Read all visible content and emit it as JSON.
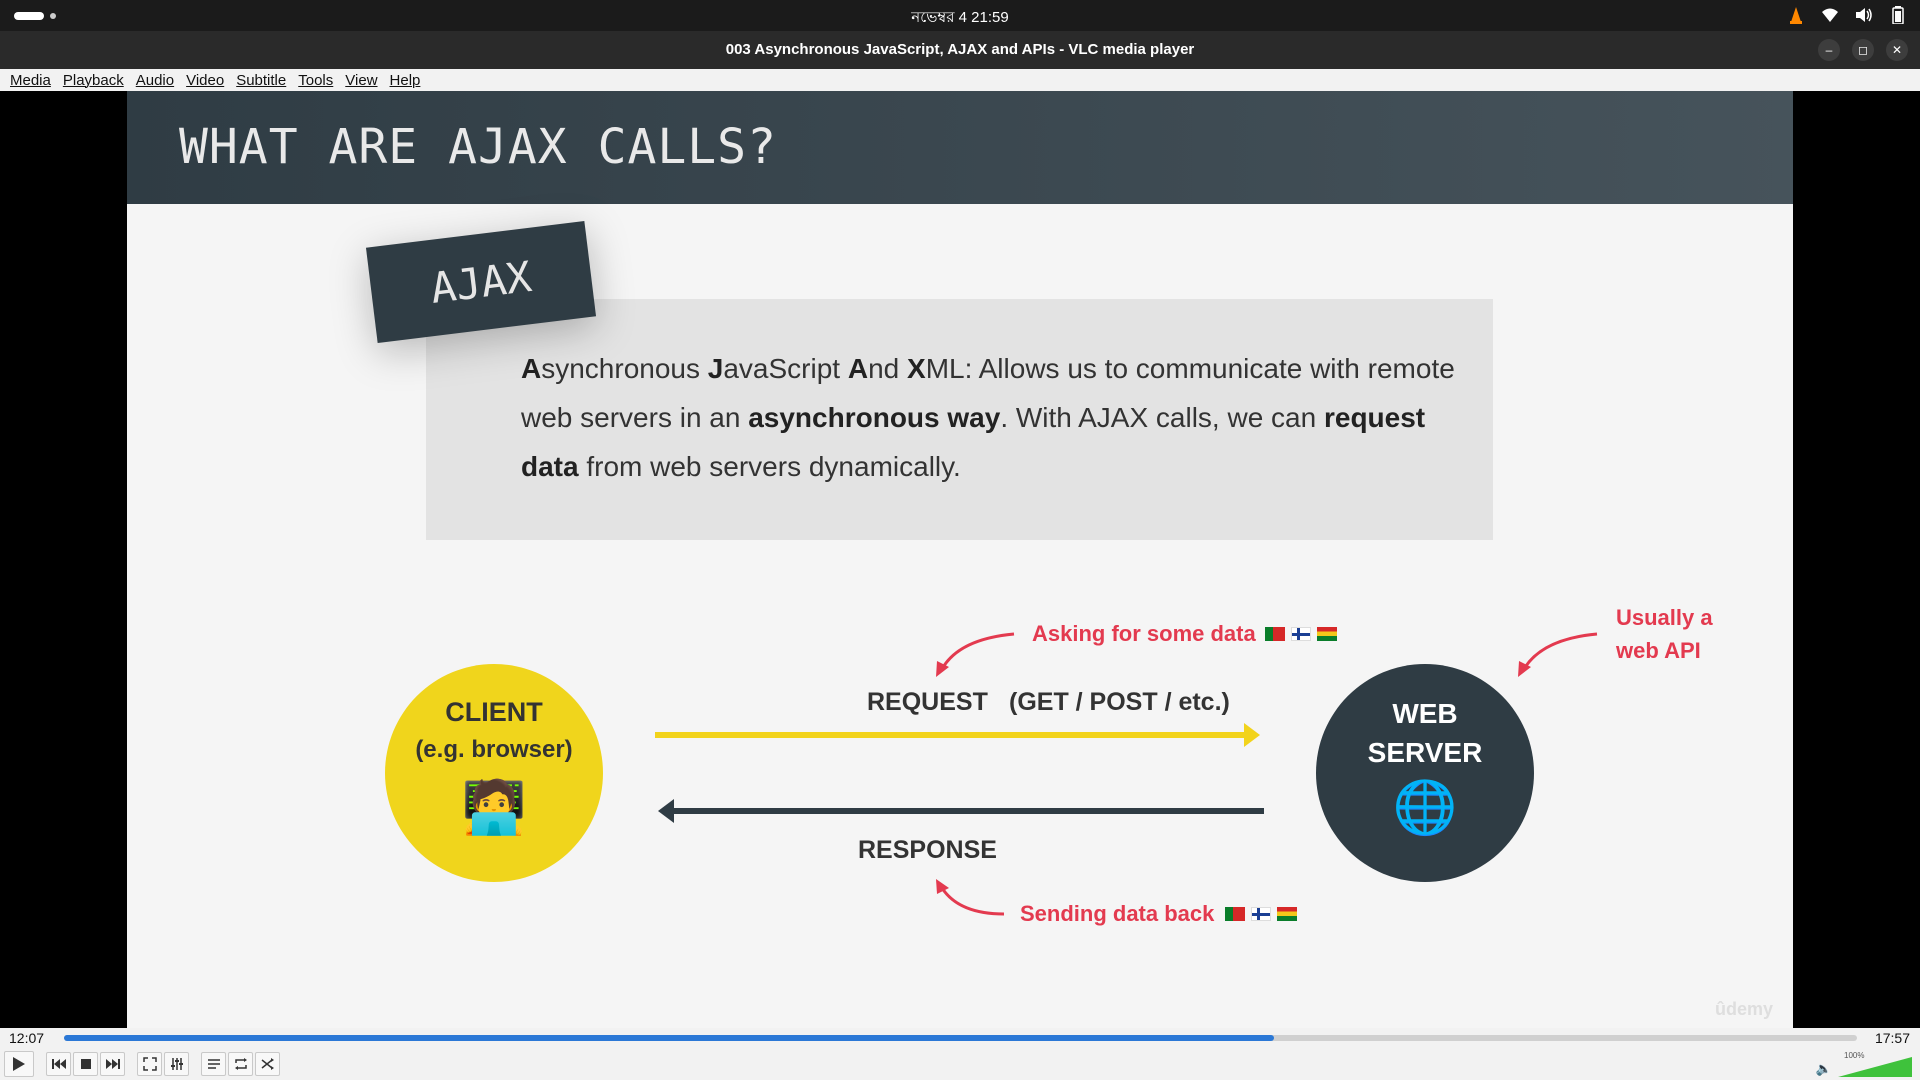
{
  "system": {
    "clock": "নভেম্বর 4  21:59",
    "tray_icons": [
      "vlc-icon",
      "wifi-icon",
      "volume-icon",
      "battery-icon"
    ]
  },
  "window": {
    "title": "003 Asynchronous JavaScript, AJAX and APIs - VLC media player",
    "minimize": "–",
    "maximize": "◻",
    "close": "✕"
  },
  "menu": [
    "Media",
    "Playback",
    "Audio",
    "Video",
    "Subtitle",
    "Tools",
    "View",
    "Help"
  ],
  "slide": {
    "title": "WHAT ARE AJAX CALLS?",
    "tag": "AJAX",
    "definition": {
      "p1_b1": "A",
      "p1_t1": "synchronous ",
      "p1_b2": "J",
      "p1_t2": "avaScript ",
      "p1_b3": "A",
      "p1_t3": "nd ",
      "p1_b4": "X",
      "p1_t4": "ML: Allows us to communicate with remote web servers in an ",
      "p1_b5": "asynchronous way",
      "p1_t5": ". With AJAX calls, we can ",
      "p1_b6": "request data",
      "p1_t6": " from web servers dynamically."
    },
    "client": {
      "line1": "CLIENT",
      "line2": "(e.g. browser)",
      "emoji": "🧑‍💻"
    },
    "server": {
      "line1": "WEB",
      "line2": "SERVER",
      "emoji": "🌐"
    },
    "request_label": "REQUEST",
    "request_methods": "(GET / POST / etc.)",
    "response_label": "RESPONSE",
    "note_asking": "Asking for some data",
    "note_sending": "Sending data back",
    "note_api_l1": "Usually a",
    "note_api_l2": "web API",
    "watermark": "ûdemy",
    "colors": {
      "header": "#2f3c44",
      "client": "#f0d51c",
      "server": "#2f3c44",
      "request_arrow": "#f2d31b",
      "note": "#e33a4f"
    }
  },
  "player": {
    "time_current": "12:07",
    "time_total": "17:57",
    "progress": 0.675,
    "volume_label": "100%",
    "volume": 1.0,
    "buttons": [
      "play-icon",
      "prev-icon",
      "stop-icon",
      "next-icon",
      "fullscreen-icon",
      "extended-settings-icon",
      "playlist-icon",
      "loop-icon",
      "shuffle-icon"
    ]
  }
}
